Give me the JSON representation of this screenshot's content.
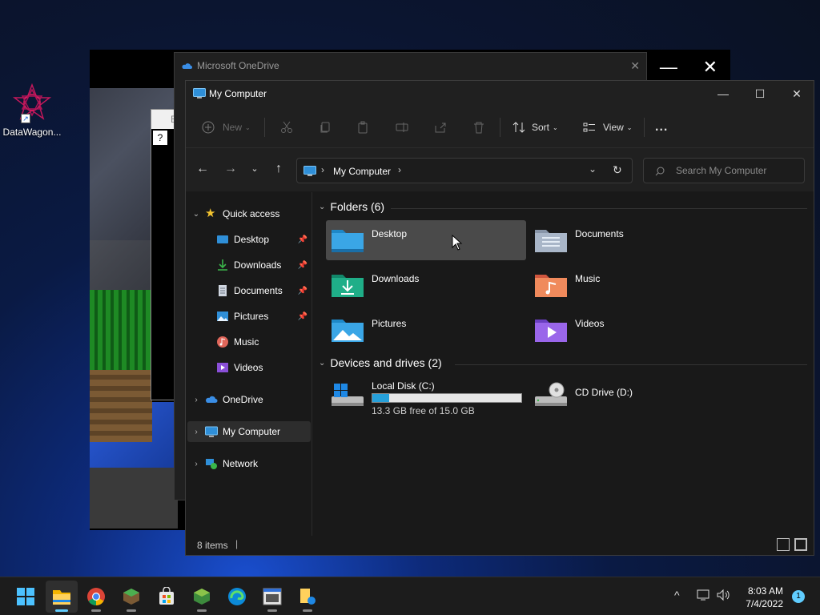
{
  "desktop": {
    "icons": [
      {
        "label": "DataWagon..."
      }
    ]
  },
  "background_windows": {
    "onedrive_title": "Microsoft OneDrive",
    "blocky_title": "Blo",
    "blocky_help": "?"
  },
  "explorer": {
    "title": "My Computer",
    "toolbar": {
      "new_label": "New",
      "sort_label": "Sort",
      "view_label": "View",
      "more_label": "..."
    },
    "address": {
      "path": "My Computer",
      "sep": "›"
    },
    "search": {
      "placeholder": "Search My Computer"
    },
    "nav": {
      "quick_access": "Quick access",
      "items": [
        {
          "label": "Desktop",
          "pinned": true
        },
        {
          "label": "Downloads",
          "pinned": true
        },
        {
          "label": "Documents",
          "pinned": true
        },
        {
          "label": "Pictures",
          "pinned": true
        },
        {
          "label": "Music",
          "pinned": false
        },
        {
          "label": "Videos",
          "pinned": false
        }
      ],
      "onedrive": "OneDrive",
      "my_computer": "My Computer",
      "network": "Network"
    },
    "folders_group": "Folders (6)",
    "folders": [
      {
        "name": "Desktop",
        "icon": "desktop-folder-icon"
      },
      {
        "name": "Documents",
        "icon": "documents-folder-icon"
      },
      {
        "name": "Downloads",
        "icon": "downloads-folder-icon"
      },
      {
        "name": "Music",
        "icon": "music-folder-icon"
      },
      {
        "name": "Pictures",
        "icon": "pictures-folder-icon"
      },
      {
        "name": "Videos",
        "icon": "videos-folder-icon"
      }
    ],
    "drives_group": "Devices and drives (2)",
    "drives": [
      {
        "name": "Local Disk (C:)",
        "free_text": "13.3 GB free of 15.0 GB",
        "used_fraction": 0.113
      },
      {
        "name": "CD Drive (D:)"
      }
    ],
    "status": {
      "item_count": "8 items",
      "cursor": "|"
    }
  },
  "taskbar": {
    "apps": [
      "start",
      "file-explorer",
      "chrome",
      "minecraft",
      "store",
      "minecraft-launcher",
      "edge",
      "blocky",
      "notes"
    ],
    "clock": {
      "time": "8:03 AM",
      "date": "7/4/2022"
    },
    "notification_count": "1"
  },
  "colors": {
    "accent": "#60cdff",
    "window_bg": "#191919",
    "selected_tile": "#4a4a4a",
    "drive_fill": "#26a0da"
  }
}
